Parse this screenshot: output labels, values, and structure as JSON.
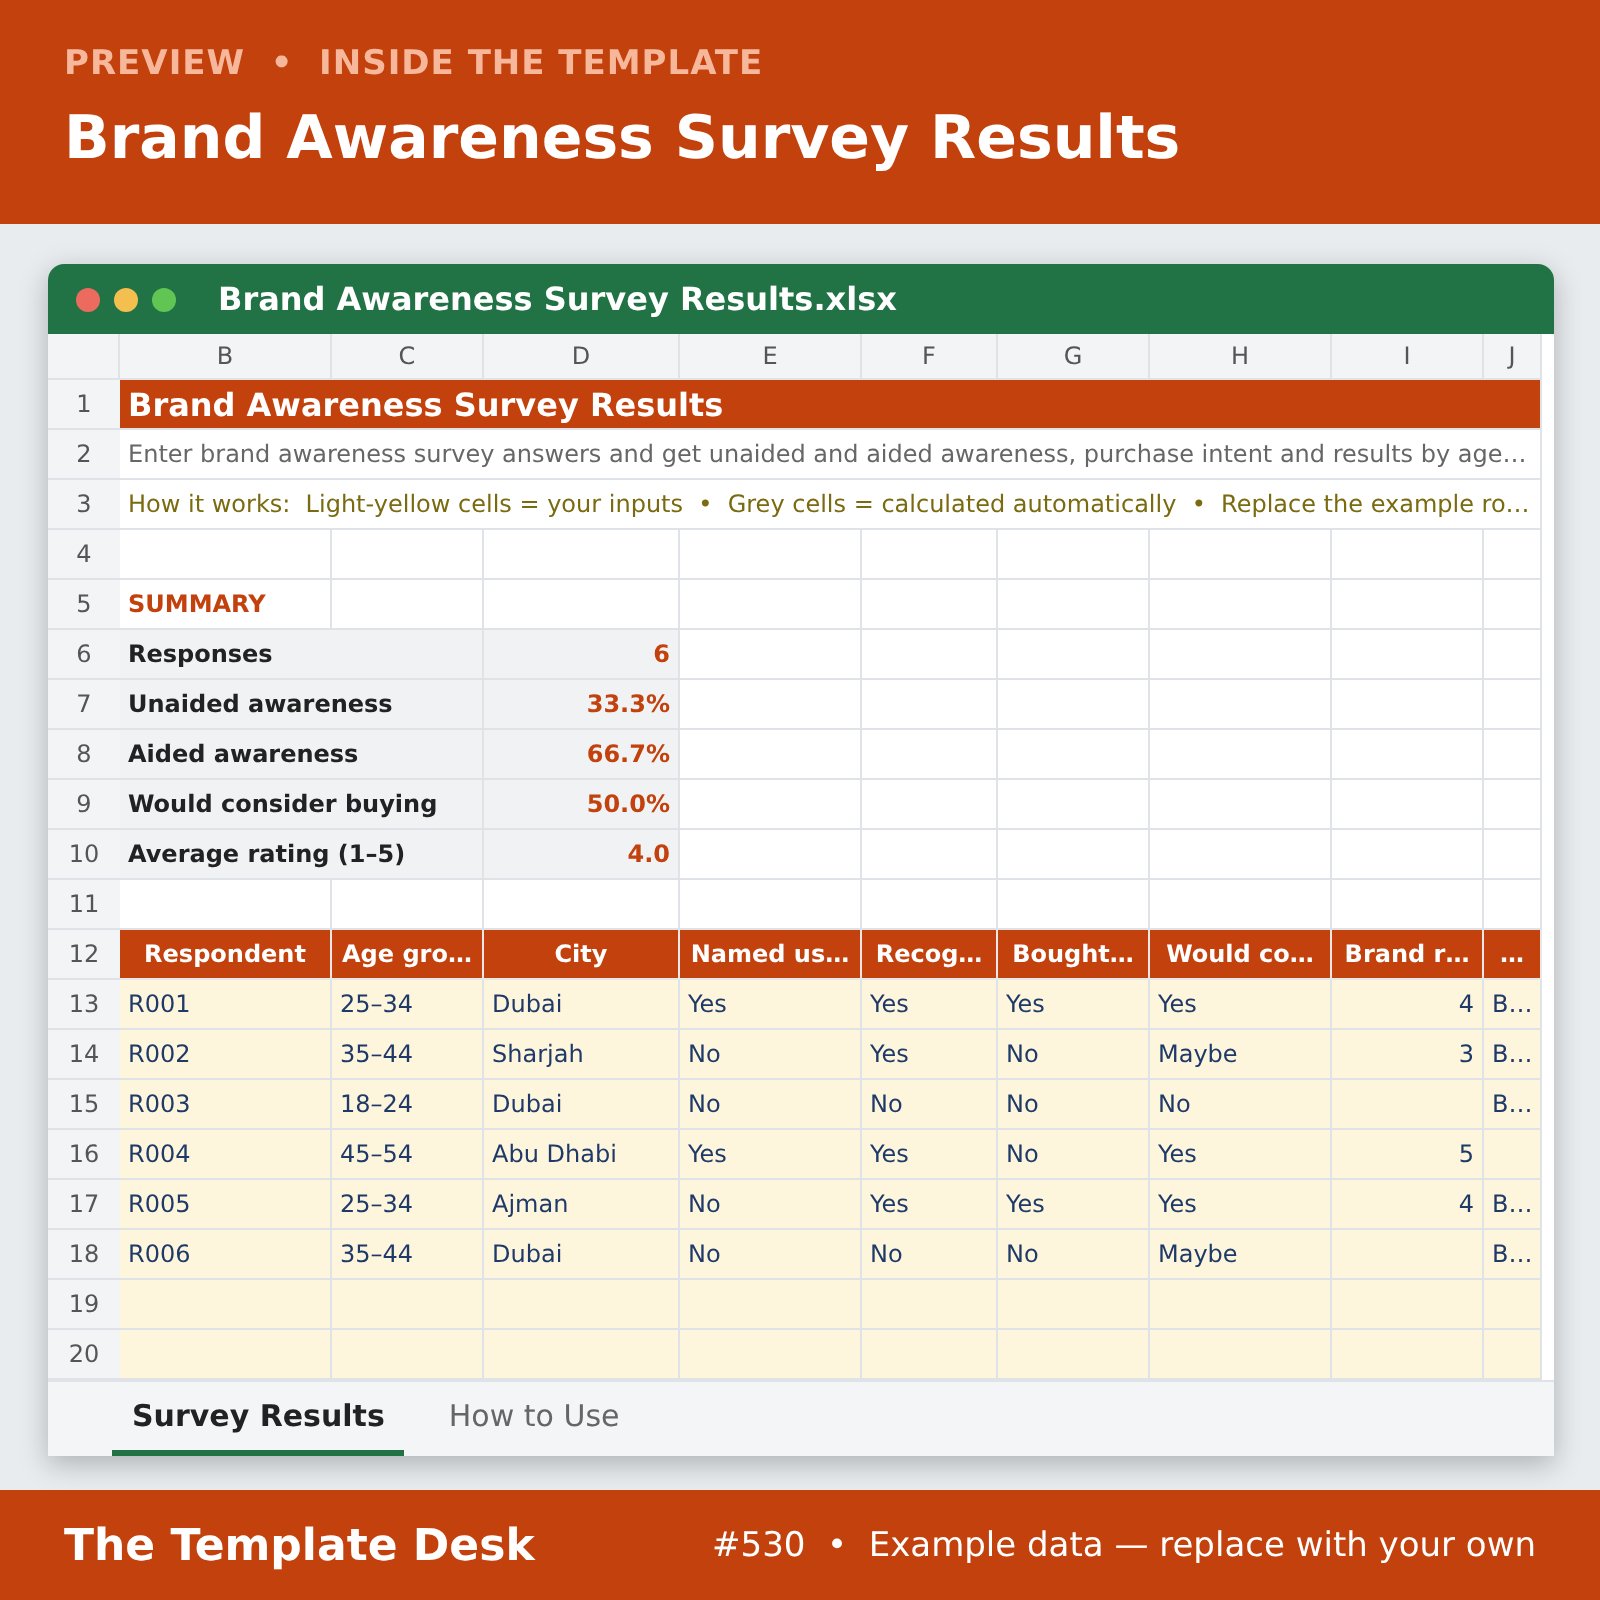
{
  "banner": {
    "kicker": "PREVIEW  •  INSIDE THE TEMPLATE",
    "title": "Brand Awareness Survey Results"
  },
  "window": {
    "title": "Brand Awareness Survey Results.xlsx"
  },
  "sheet": {
    "column_letters": [
      "B",
      "C",
      "D",
      "E",
      "F",
      "G",
      "H",
      "I",
      "J"
    ],
    "row_numbers": [
      "1",
      "2",
      "3",
      "4",
      "5",
      "6",
      "7",
      "8",
      "9",
      "10",
      "11",
      "12",
      "13",
      "14",
      "15",
      "16",
      "17",
      "18",
      "19",
      "20"
    ],
    "title": "Brand Awareness Survey Results",
    "description": "Enter brand awareness survey answers and get unaided and aided awareness, purchase intent and results by age…",
    "how_it_works": "How it works:  Light-yellow cells = your inputs  •  Grey cells = calculated automatically  •  Replace the example ro…",
    "summary_heading": "SUMMARY",
    "summary": [
      {
        "label": "Responses",
        "value": "6"
      },
      {
        "label": "Unaided awareness",
        "value": "33.3%"
      },
      {
        "label": "Aided awareness",
        "value": "66.7%"
      },
      {
        "label": "Would consider buying",
        "value": "50.0%"
      },
      {
        "label": "Average rating (1–5)",
        "value": "4.0"
      }
    ],
    "table": {
      "columns": [
        {
          "label": "Respondent",
          "kind": "text"
        },
        {
          "label": "Age gro…",
          "kind": "text"
        },
        {
          "label": "City",
          "kind": "text"
        },
        {
          "label": "Named us…",
          "kind": "text"
        },
        {
          "label": "Recog…",
          "kind": "text"
        },
        {
          "label": "Bought…",
          "kind": "text"
        },
        {
          "label": "Would co…",
          "kind": "text"
        },
        {
          "label": "Brand r…",
          "kind": "number"
        },
        {
          "label": "…",
          "kind": "text"
        }
      ],
      "rows": [
        [
          "R001",
          "25–34",
          "Dubai",
          "Yes",
          "Yes",
          "Yes",
          "Yes",
          "4",
          "B…"
        ],
        [
          "R002",
          "35–44",
          "Sharjah",
          "No",
          "Yes",
          "No",
          "Maybe",
          "3",
          "B…"
        ],
        [
          "R003",
          "18–24",
          "Dubai",
          "No",
          "No",
          "No",
          "No",
          "",
          "B…"
        ],
        [
          "R004",
          "45–54",
          "Abu Dhabi",
          "Yes",
          "Yes",
          "No",
          "Yes",
          "5",
          ""
        ],
        [
          "R005",
          "25–34",
          "Ajman",
          "No",
          "Yes",
          "Yes",
          "Yes",
          "4",
          "B…"
        ],
        [
          "R006",
          "35–44",
          "Dubai",
          "No",
          "No",
          "No",
          "Maybe",
          "",
          "B…"
        ]
      ]
    }
  },
  "tabs": [
    {
      "label": "Survey Results",
      "selected": true
    },
    {
      "label": "How to Use",
      "selected": false
    }
  ],
  "footer": {
    "brand": "The Template Desk",
    "note": "#530  •  Example data — replace with your own"
  }
}
